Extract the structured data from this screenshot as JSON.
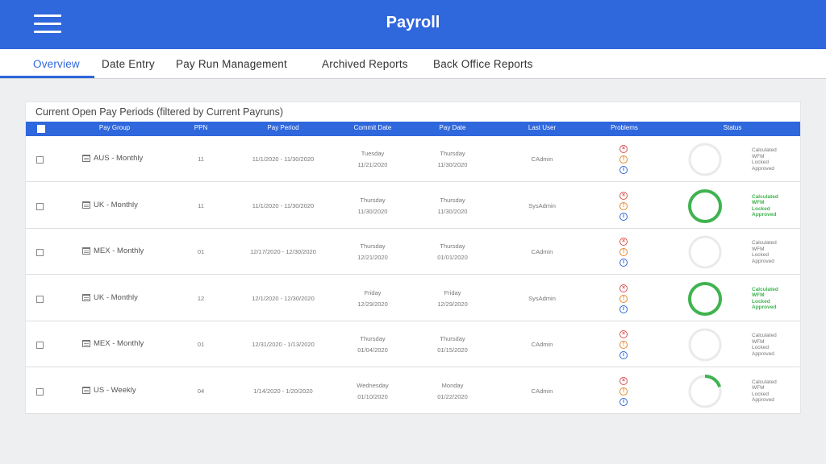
{
  "header": {
    "title": "Payroll"
  },
  "tabs": [
    {
      "label": "Overview",
      "active": true
    },
    {
      "label": "Date Entry"
    },
    {
      "label": "Pay Run Management"
    },
    {
      "label": "Archived Reports"
    },
    {
      "label": "Back Office Reports"
    }
  ],
  "panel": {
    "title": "Current Open Pay Periods (filtered by Current Payruns)"
  },
  "columns": [
    "Pay Group",
    "PPN",
    "Pay Period",
    "Commit Date",
    "Pay Date",
    "Last User",
    "Problems",
    "Status"
  ],
  "colors": {
    "brand": "#2f67dc",
    "complete": "#3fb34f",
    "ring_track": "#e9eaec"
  },
  "rows": [
    {
      "group": "AUS - Monthly",
      "ppn": "11",
      "period": "11/1/2020 - 11/30/2020",
      "commit_day": "Tuesday",
      "commit_date": "11/21/2020",
      "pay_day": "Thursday",
      "pay_date": "11/30/2020",
      "user": "CAdmin",
      "progress": 0,
      "status": [
        "Calculated",
        "WFM",
        "Locked",
        "Approved"
      ]
    },
    {
      "group": "UK - Monthly",
      "ppn": "11",
      "period": "11/1/2020 - 11/30/2020",
      "commit_day": "Thursday",
      "commit_date": "11/30/2020",
      "pay_day": "Thursday",
      "pay_date": "11/30/2020",
      "user": "SysAdmin",
      "progress": 1,
      "status": [
        "Calculated",
        "WFM",
        "Locked",
        "Approved"
      ]
    },
    {
      "group": "MEX - Monthly",
      "ppn": "01",
      "period": "12/17/2020 - 12/30/2020",
      "commit_day": "Thursday",
      "commit_date": "12/21/2020",
      "pay_day": "Thursday",
      "pay_date": "01/01/2020",
      "user": "CAdmin",
      "progress": 0,
      "status": [
        "Calculated",
        "WFM",
        "Locked",
        "Approved"
      ]
    },
    {
      "group": "UK - Monthly",
      "ppn": "12",
      "period": "12/1/2020 - 12/30/2020",
      "commit_day": "Friday",
      "commit_date": "12/29/2020",
      "pay_day": "Friday",
      "pay_date": "12/29/2020",
      "user": "SysAdmin",
      "progress": 1,
      "status": [
        "Calculated",
        "WFM",
        "Locked",
        "Approved"
      ]
    },
    {
      "group": "MEX - Monthly",
      "ppn": "01",
      "period": "12/31/2020 - 1/13/2020",
      "commit_day": "Thursday",
      "commit_date": "01/04/2020",
      "pay_day": "Thursday",
      "pay_date": "01/15/2020",
      "user": "CAdmin",
      "progress": 0,
      "status": [
        "Calculated",
        "WFM",
        "Locked",
        "Approved"
      ]
    },
    {
      "group": "US - Weekly",
      "ppn": "04",
      "period": "1/14/2020 - 1/20/2020",
      "commit_day": "Wednesday",
      "commit_date": "01/10/2020",
      "pay_day": "Monday",
      "pay_date": "01/22/2020",
      "user": "CAdmin",
      "progress": 0.2,
      "status": [
        "Calculated",
        "WFM",
        "Locked",
        "Approved"
      ]
    }
  ]
}
